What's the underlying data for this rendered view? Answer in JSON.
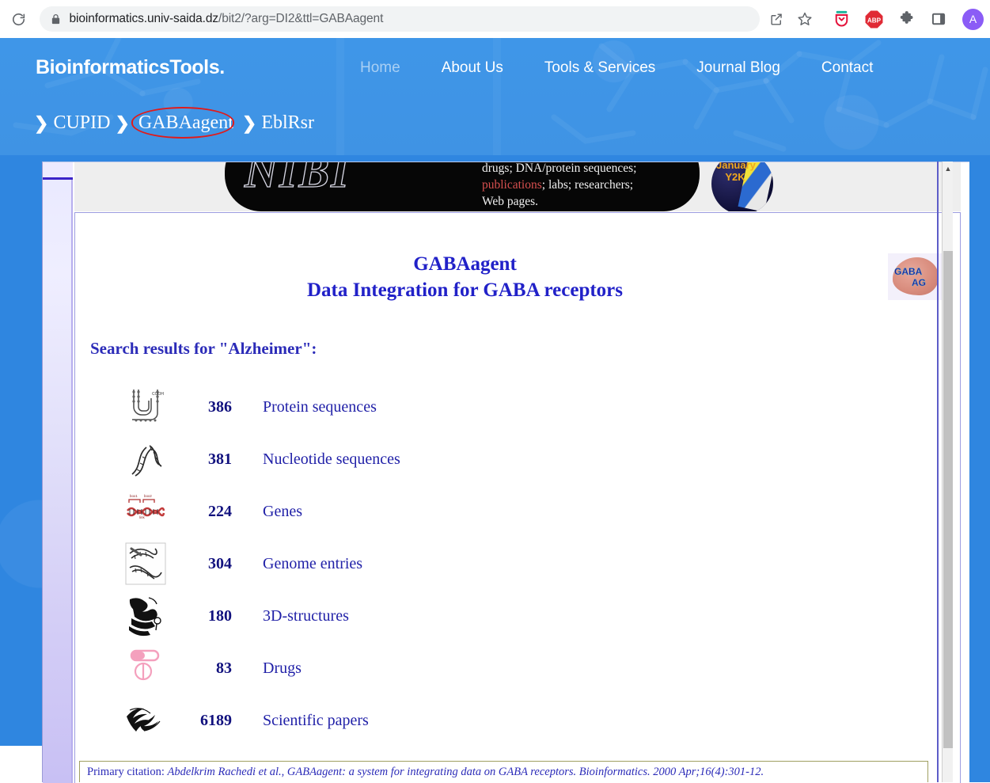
{
  "browser": {
    "reload_icon": "reload-icon",
    "lock_icon": "lock-icon",
    "url_prefix": "bioinformatics.univ-saida.dz",
    "url_suffix": "/bit2/?arg=DI2&ttl=GABAagent",
    "share_icon": "share-icon",
    "bookmark_icon": "star-icon",
    "extensions": [
      {
        "name": "pocket-icon",
        "label": ""
      },
      {
        "name": "adblock-plus-icon",
        "label": "ABP"
      },
      {
        "name": "puzzle-extensions-icon",
        "label": ""
      },
      {
        "name": "sidepanel-icon",
        "label": ""
      }
    ],
    "avatar_letter": "A",
    "avatar_color": "#8b5cf6"
  },
  "site_header": {
    "brand": "BioinformaticsTools.",
    "background_color": "#3f93e4",
    "nav": [
      {
        "label": "Home",
        "active": true
      },
      {
        "label": "About Us",
        "active": false
      },
      {
        "label": "Tools & Services",
        "active": false
      },
      {
        "label": "Journal Blog",
        "active": false
      },
      {
        "label": "Contact",
        "active": false
      }
    ],
    "breadcrumb": {
      "chevron": "❯",
      "items": [
        "CUPID",
        "GABAagent",
        "EblRsr"
      ],
      "highlighted_index": 1,
      "highlight_color": "#e01b1b"
    }
  },
  "banner": {
    "logo_text": "NIBI",
    "description_line1": "drugs; DNA/protein sequences;",
    "description_line2_red": "publications",
    "description_line2_rest": "; labs; researchers;",
    "description_line3": "Web pages.",
    "badge_line1": "January",
    "badge_line2": "Y2K"
  },
  "page": {
    "title_line1": "GABAagent",
    "title_line2": "Data Integration for GABA receptors",
    "logo_label_1": "GABA",
    "logo_label_2": "AG",
    "results_heading": "Search results for \"Alzheimer\":",
    "results": [
      {
        "icon": "protein-sequence-icon",
        "count": "386",
        "label": "Protein sequences"
      },
      {
        "icon": "dna-helix-icon",
        "count": "381",
        "label": "Nucleotide sequences"
      },
      {
        "icon": "gene-map-icon",
        "count": "224",
        "label": "Genes"
      },
      {
        "icon": "genome-icon",
        "count": "304",
        "label": "Genome entries"
      },
      {
        "icon": "3d-structure-icon",
        "count": "180",
        "label": "3D-structures"
      },
      {
        "icon": "drug-pill-icon",
        "count": "83",
        "label": "Drugs"
      },
      {
        "icon": "scientific-paper-icon",
        "count": "6189",
        "label": "Scientific papers"
      }
    ],
    "citation_prefix": "Primary citation: ",
    "citation_body": "Abdelkrim Rachedi et al., GABAagent: a system for integrating data on GABA receptors. Bioinformatics. 2000 Apr;16(4):301-12."
  },
  "scrollbar": {
    "up_arrow": "▲"
  }
}
